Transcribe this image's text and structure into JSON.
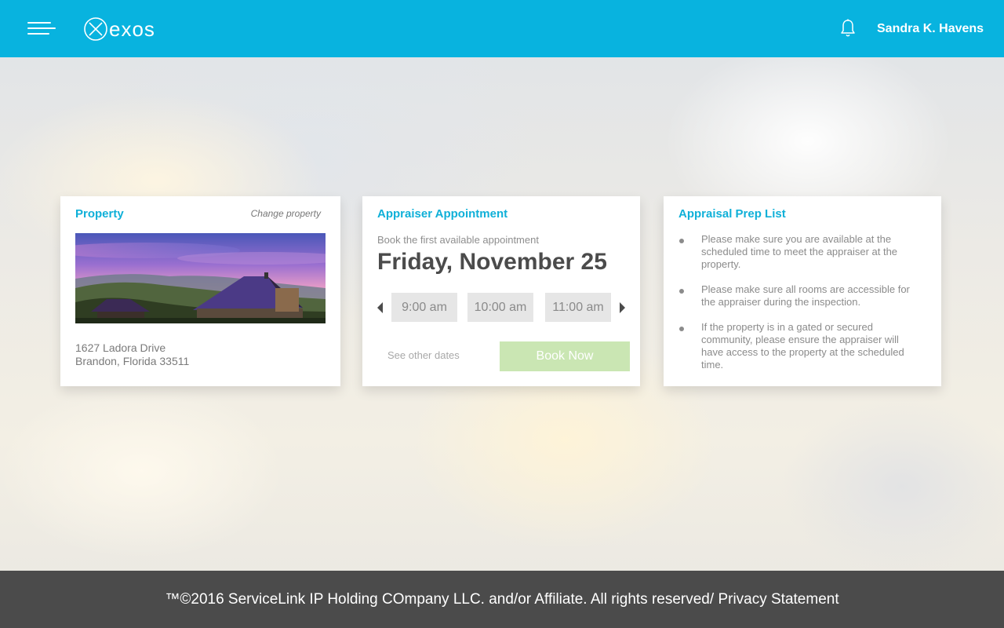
{
  "header": {
    "logo_text": "exos",
    "user_name": "Sandra K. Havens",
    "icons": {
      "menu": "hamburger-icon",
      "notifications": "bell-icon"
    },
    "background_color": "#08b3df"
  },
  "property_card": {
    "title": "Property",
    "change_link": "Change property",
    "address_line1": "1627 Ladora Drive",
    "address_line2": "Brandon, Florida 33511"
  },
  "appointment_card": {
    "title": "Appraiser Appointment",
    "subtitle": "Book the first available appointment",
    "date": "Friday, November 25",
    "time_slots": [
      "9:00 am",
      "10:00 am",
      "11:00 am"
    ],
    "other_dates": "See other dates",
    "book_button": "Book Now"
  },
  "prep_card": {
    "title": "Appraisal Prep List",
    "items": [
      "Please make sure you are available at the scheduled time to meet the appraiser at the property.",
      "Please make sure all rooms are accessible for the appraiser during the inspection.",
      "If the property is in a gated or secured community, please ensure the appraiser will have access to the property at the scheduled time."
    ]
  },
  "footer": {
    "copyright": "™©2016 ServiceLink IP Holding COmpany LLC. and/or Affiliate. All rights reserved/",
    "privacy_link": "Privacy Statement"
  },
  "colors": {
    "accent": "#0fb0d8",
    "book_button": "#cae6b3",
    "footer": "#4b4b4b"
  }
}
